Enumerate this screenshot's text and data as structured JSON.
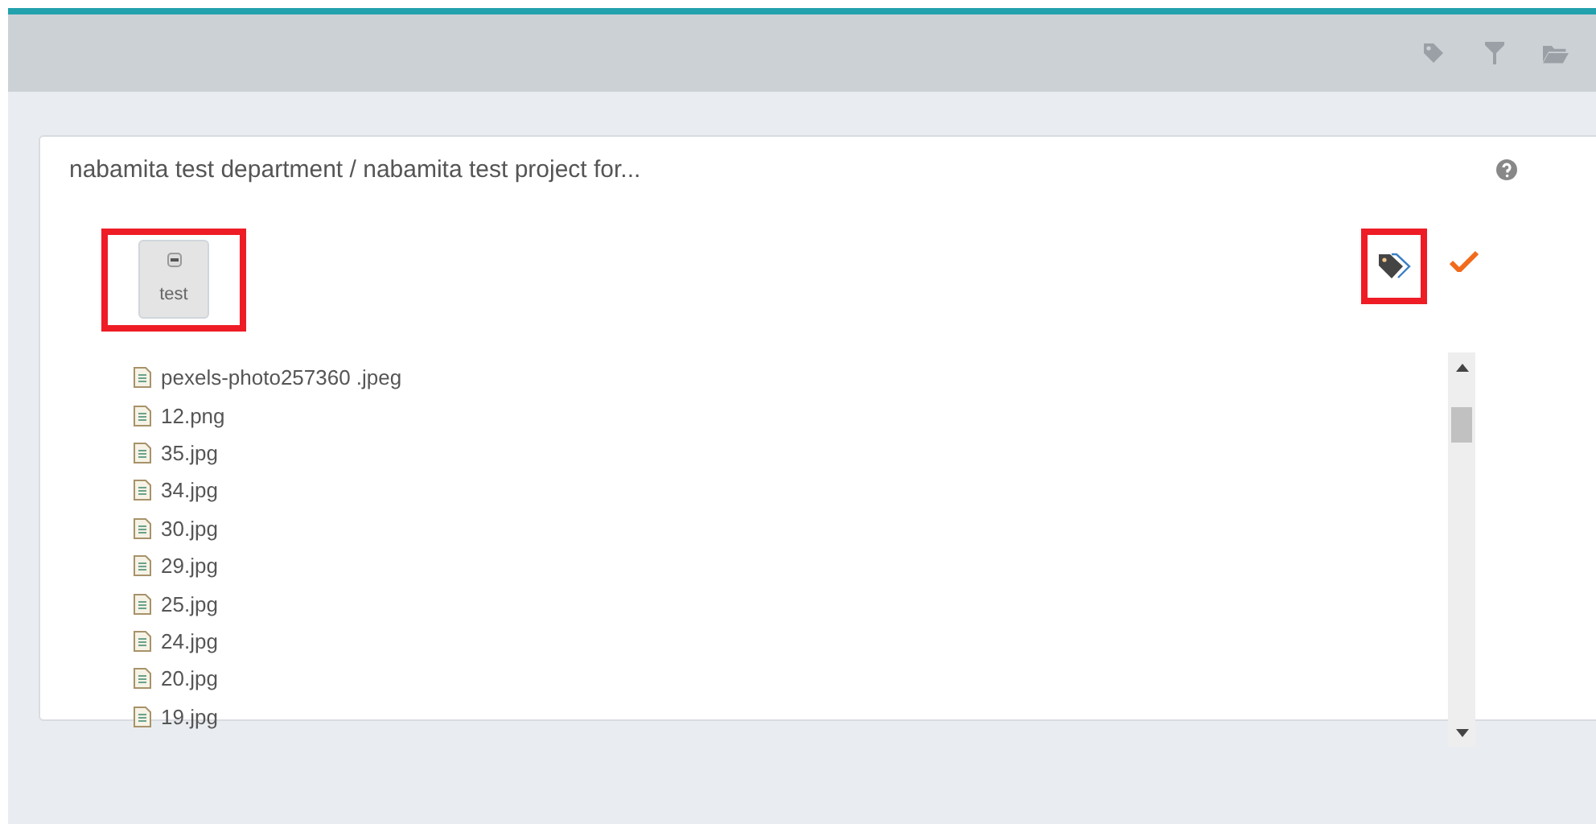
{
  "card": {
    "title": "nabamita test department / nabamita test project for..."
  },
  "tag_chip": {
    "label": "test",
    "highlighted": true
  },
  "tag_button": {
    "highlighted": true
  },
  "files": [
    {
      "name": "pexels-photo257360 .jpeg"
    },
    {
      "name": "12.png"
    },
    {
      "name": "35.jpg"
    },
    {
      "name": "34.jpg"
    },
    {
      "name": "30.jpg"
    },
    {
      "name": "29.jpg"
    },
    {
      "name": "25.jpg"
    },
    {
      "name": "24.jpg"
    },
    {
      "name": "20.jpg"
    },
    {
      "name": "19.jpg"
    }
  ]
}
